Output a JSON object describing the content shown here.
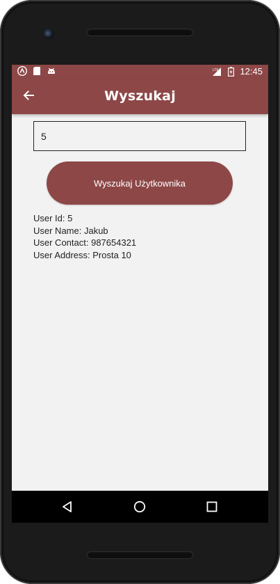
{
  "status_bar": {
    "time": "12:45",
    "left_icons": [
      "app-icon",
      "sd-card-icon",
      "android-icon"
    ],
    "right_icons": [
      "lte-signal-icon",
      "battery-icon"
    ],
    "color": "#8d4747"
  },
  "app_bar": {
    "title": "Wyszukaj",
    "back_icon": "arrow-back-icon",
    "color": "#8d4747"
  },
  "search": {
    "value": "5",
    "button_label": "Wyszukaj Użytkownika"
  },
  "result": {
    "lines": [
      "User Id: 5",
      "User Name: Jakub",
      "User Contact: 987654321",
      "User Address: Prosta 10"
    ]
  },
  "nav_bar": {
    "icons": [
      "back-triangle-icon",
      "home-circle-icon",
      "recent-square-icon"
    ]
  }
}
